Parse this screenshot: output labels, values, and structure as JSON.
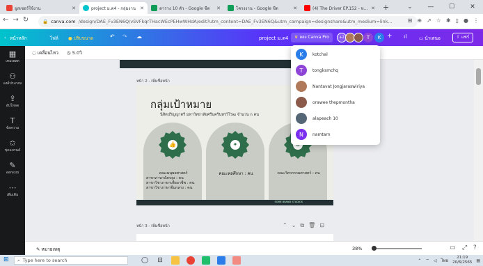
{
  "browser": {
    "tabs": [
      {
        "label": "ยูสเซอร์ใช้งาน",
        "color": "#ea4335"
      },
      {
        "label": "project ม.ต4 - กลุ่มงาน",
        "color": "#fbbc04",
        "active": true
      },
      {
        "label": "ตาราง 10 ตัว - Google ชีต",
        "color": "#0f9d58"
      },
      {
        "label": "โครงงาน - Google ชีต",
        "color": "#0f9d58"
      },
      {
        "label": "(4) The Driver EP.152 - หนุ่ม",
        "color": "#ff0000"
      }
    ],
    "new_tab": "+",
    "window_controls": [
      "⌄",
      "—",
      "☐",
      "✕"
    ],
    "url_host": "canva.com",
    "url_path": "/design/DAE_Fv3EN6Q/vSVFkqrTHacWEcPEHwWHdA/edit?utm_content=DAE_Fv3EN6Q&utm_campaign=designshare&utm_medium=link..."
  },
  "canva_header": {
    "home": "หน้าหลัก",
    "file": "ไฟล์",
    "resize": "ปรับขนาด",
    "project_name": "project ม.ต4",
    "try_pro": "ลอง Canva Pro",
    "collaborator_count": "+2",
    "share": "แชร์",
    "print": "นำเสนอ"
  },
  "rail": [
    {
      "icon": "template-icon",
      "label": "เทมเพลต",
      "glyph": "▦"
    },
    {
      "icon": "elements-icon",
      "label": "องค์ประกอบ",
      "glyph": "⚇"
    },
    {
      "icon": "upload-icon",
      "label": "อัปโหลด",
      "glyph": "⇪"
    },
    {
      "icon": "text-icon",
      "label": "ข้อความ",
      "glyph": "T"
    },
    {
      "icon": "brand-icon",
      "label": "ชุดแบรนด์",
      "glyph": "✩"
    },
    {
      "icon": "draw-icon",
      "label": "ออกแบบ",
      "glyph": "✎"
    },
    {
      "icon": "more-icon",
      "label": "เพิ่มเติม",
      "glyph": "⋯"
    }
  ],
  "toolbar": {
    "animate": "เคลื่อนไหว",
    "duration": "5.0วิ"
  },
  "page2_label": "หน้า 2 - เพิ่มชื่อหน้า",
  "slide": {
    "title": "กลุ่มเป้าหมาย",
    "subtitle": "นิสิตปริญญาตรี มหาวิทยาลัยศรีนครินทรวิโรฒ จำนวน n คน",
    "cards": [
      {
        "lines": [
          "คณะมนุษยศาสตร์",
          "สาขาภาษาอังกฤษ : คน",
          "สาขาวิชาภาษาเพื่ออาชีพ : คน",
          "สาขาวิชาภาษาจีนกลาง : คน"
        ]
      },
      {
        "lines": [
          "คณะพลศึกษา : คน"
        ]
      },
      {
        "lines": [
          "คณะวิศวกรรมศาสตร์ : คน"
        ]
      }
    ],
    "footer": "SOME BRAND STUDIOS"
  },
  "page3_label": "หน้า 3 - เพิ่มชื่อหน้า",
  "bottom": {
    "notes": "หมายเหตุ",
    "zoom": "38%"
  },
  "collaborators": [
    {
      "name": "kotchal",
      "initial": "K",
      "color": "#2b7de9"
    },
    {
      "name": "tongksmchq",
      "initial": "T",
      "color": "#8e44d6"
    },
    {
      "name": "Nantavat Jongjaraswiriya",
      "initial": "",
      "color": "#b07a5a"
    },
    {
      "name": "orawee thepmontha",
      "initial": "",
      "color": "#8b5a4b"
    },
    {
      "name": "alapeach 10",
      "initial": "",
      "color": "#556677"
    },
    {
      "name": "namtarn",
      "initial": "N",
      "color": "#7b2ff0"
    }
  ],
  "taskbar": {
    "search_placeholder": "Type here to search",
    "time": "21:19",
    "date": "20/6/2565",
    "lang": "ไทย"
  }
}
